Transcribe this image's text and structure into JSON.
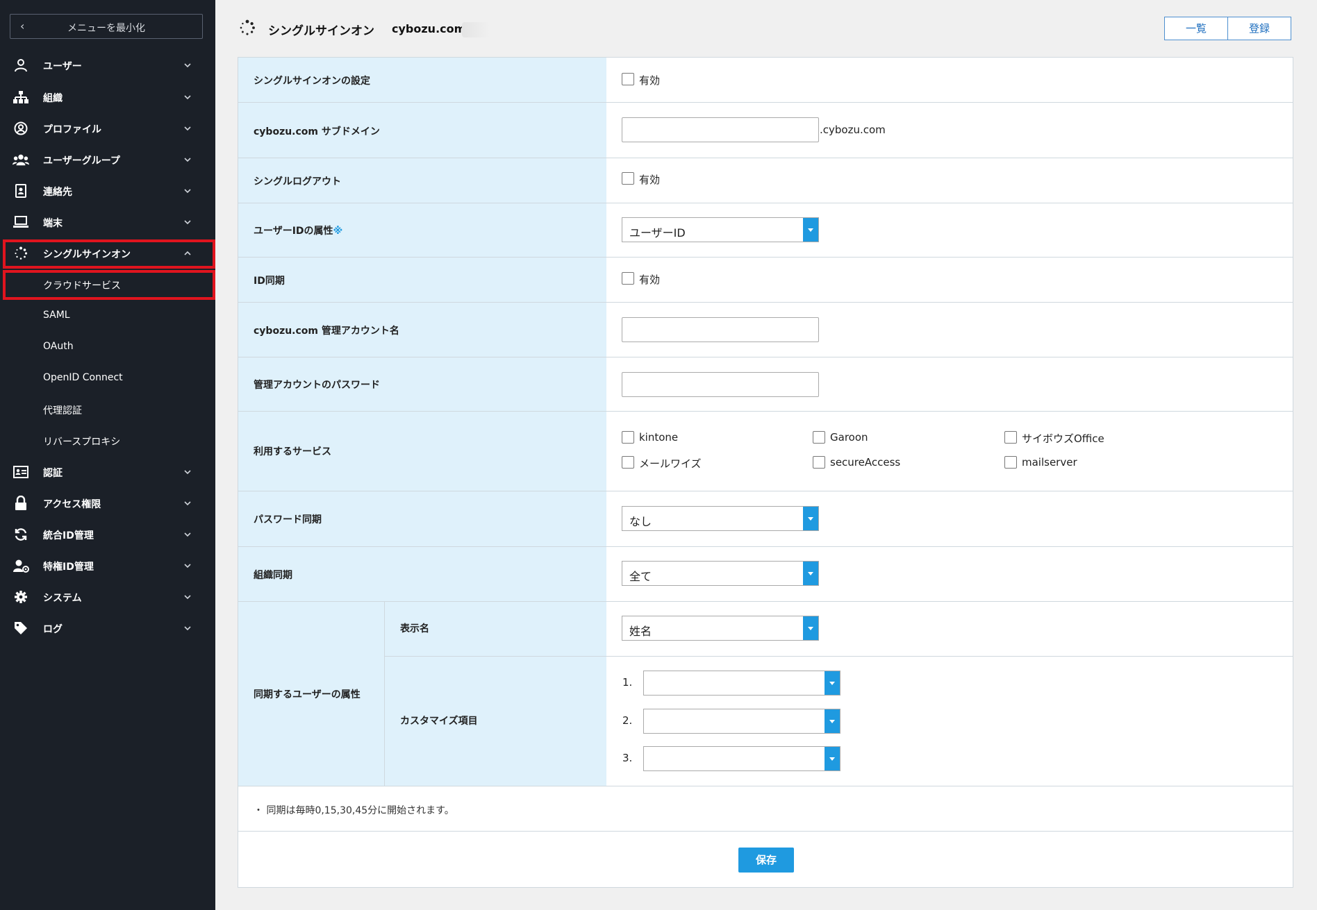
{
  "sidebar": {
    "minimize_label": "メニューを最小化",
    "items": [
      {
        "label": "ユーザー",
        "icon": "user-icon"
      },
      {
        "label": "組織",
        "icon": "org-icon"
      },
      {
        "label": "プロファイル",
        "icon": "profile-icon"
      },
      {
        "label": "ユーザーグループ",
        "icon": "group-icon"
      },
      {
        "label": "連絡先",
        "icon": "contact-icon"
      },
      {
        "label": "端末",
        "icon": "laptop-icon"
      },
      {
        "label": "シングルサインオン",
        "icon": "sso-icon"
      },
      {
        "label": "認証",
        "icon": "id-card-icon"
      },
      {
        "label": "アクセス権限",
        "icon": "lock-icon"
      },
      {
        "label": "統合ID管理",
        "icon": "sync-icon"
      },
      {
        "label": "特権ID管理",
        "icon": "admin-user-icon"
      },
      {
        "label": "システム",
        "icon": "gear-icon"
      },
      {
        "label": "ログ",
        "icon": "tag-icon"
      }
    ],
    "sso_subitems": [
      "クラウドサービス",
      "SAML",
      "OAuth",
      "OpenID Connect",
      "代理認証",
      "リバースプロキシ"
    ]
  },
  "header": {
    "title": "シングルサインオン",
    "domain": "cybozu.com",
    "list_button": "一覧",
    "register_button": "登録"
  },
  "form": {
    "sso_setting": {
      "label": "シングルサインオンの設定",
      "checkbox": "有効"
    },
    "subdomain": {
      "label": "cybozu.com サブドメイン",
      "suffix": ".cybozu.com",
      "value": ""
    },
    "single_logout": {
      "label": "シングルログアウト",
      "checkbox": "有効"
    },
    "userid_attr": {
      "label": "ユーザーIDの属性",
      "mark": "※",
      "selected": "ユーザーID"
    },
    "id_sync": {
      "label": "ID同期",
      "checkbox": "有効"
    },
    "admin_account": {
      "label": "cybozu.com 管理アカウント名",
      "value": ""
    },
    "admin_password": {
      "label": "管理アカウントのパスワード",
      "value": ""
    },
    "services": {
      "label": "利用するサービス",
      "options": [
        "kintone",
        "Garoon",
        "サイボウズOffice",
        "メールワイズ",
        "secureAccess",
        "mailserver"
      ]
    },
    "password_sync": {
      "label": "パスワード同期",
      "selected": "なし"
    },
    "org_sync": {
      "label": "組織同期",
      "selected": "全て"
    },
    "user_attr": {
      "label": "同期するユーザーの属性",
      "display_name": {
        "label": "表示名",
        "selected": "姓名"
      },
      "custom": {
        "label": "カスタマイズ項目",
        "items": [
          "1.",
          "2.",
          "3."
        ]
      }
    },
    "note": "・ 同期は毎時0,15,30,45分に開始されます。",
    "save_button": "保存"
  },
  "colors": {
    "accent": "#1f9ae0",
    "sidebar_bg": "#1b2028",
    "label_bg": "#dff1fb",
    "highlight": "#e0141e"
  }
}
